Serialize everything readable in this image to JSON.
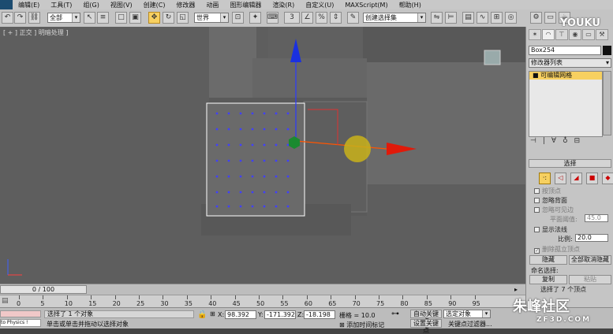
{
  "menubar": {
    "items": [
      "编辑(E)",
      "工具(T)",
      "组(G)",
      "视图(V)",
      "创建(C)",
      "修改器",
      "动画",
      "图形编辑器",
      "渲染(R)",
      "自定义(U)",
      "MAXScript(M)",
      "帮助(H)"
    ]
  },
  "watermark": {
    "brand": "YOUKU",
    "sub": "优酷"
  },
  "toolbar": {
    "selection_filter": "全部",
    "ref_coord": "世界",
    "snap_value": "3",
    "named_selection": "创建选择集"
  },
  "viewport": {
    "label": "[ + ] 正交 ] 明暗处理 ]"
  },
  "panel": {
    "object_name": "Box254",
    "modifier_list": "修改器列表",
    "stack_item": "可编辑网格",
    "rollout_title": "选择",
    "checkboxes": [
      {
        "label": "按顶点",
        "checked": false,
        "enabled": false
      },
      {
        "label": "忽略背面",
        "checked": false,
        "enabled": true
      },
      {
        "label": "忽略可见边",
        "checked": false,
        "enabled": false
      },
      {
        "label": "平面阈值:",
        "value": "45.0",
        "enabled": false
      },
      {
        "label": "显示法线",
        "checked": false,
        "enabled": true
      },
      {
        "label": "比例:",
        "value": "20.0",
        "enabled": true
      },
      {
        "label": "删除孤立顶点",
        "checked": true,
        "enabled": false
      }
    ],
    "hide_button": "隐藏",
    "unhide_button": "全部取消隐藏",
    "named_sel_label": "命名选择:",
    "copy_button": "复制",
    "paste_button": "粘贴",
    "selection_info": "选择了 7 个顶点"
  },
  "timeline": {
    "frame": "0 / 100",
    "ticks": [
      "0",
      "5",
      "10",
      "15",
      "20",
      "25",
      "30",
      "35",
      "40",
      "45",
      "50",
      "55",
      "60",
      "65",
      "70",
      "75",
      "80",
      "85",
      "90",
      "95"
    ]
  },
  "status": {
    "script_listener": "to Physics !",
    "msg1": "选择了 1 个对象",
    "msg2": "单击或单击并拖动以选择对象",
    "x_label": "X:",
    "x": "98.392",
    "y_label": "Y:",
    "y": "-171.392",
    "z_label": "Z:",
    "z": "-18.198",
    "grid": "栅格 = 10.0",
    "add_time_tag": "添加时间标记",
    "auto_key": "自动关键点",
    "set_key": "设置关键点",
    "key_mode": "选定对象",
    "key_filters": "关键点过滤器..."
  },
  "site_watermark": {
    "name": "朱峰社区",
    "url": "ZF3D.COM"
  },
  "colors": {
    "accent": "#f7d060",
    "vertex": "#3a3aff",
    "axis_x": "#e01a0a",
    "axis_y": "#1a30e0",
    "axis_z": "#1aa030"
  }
}
